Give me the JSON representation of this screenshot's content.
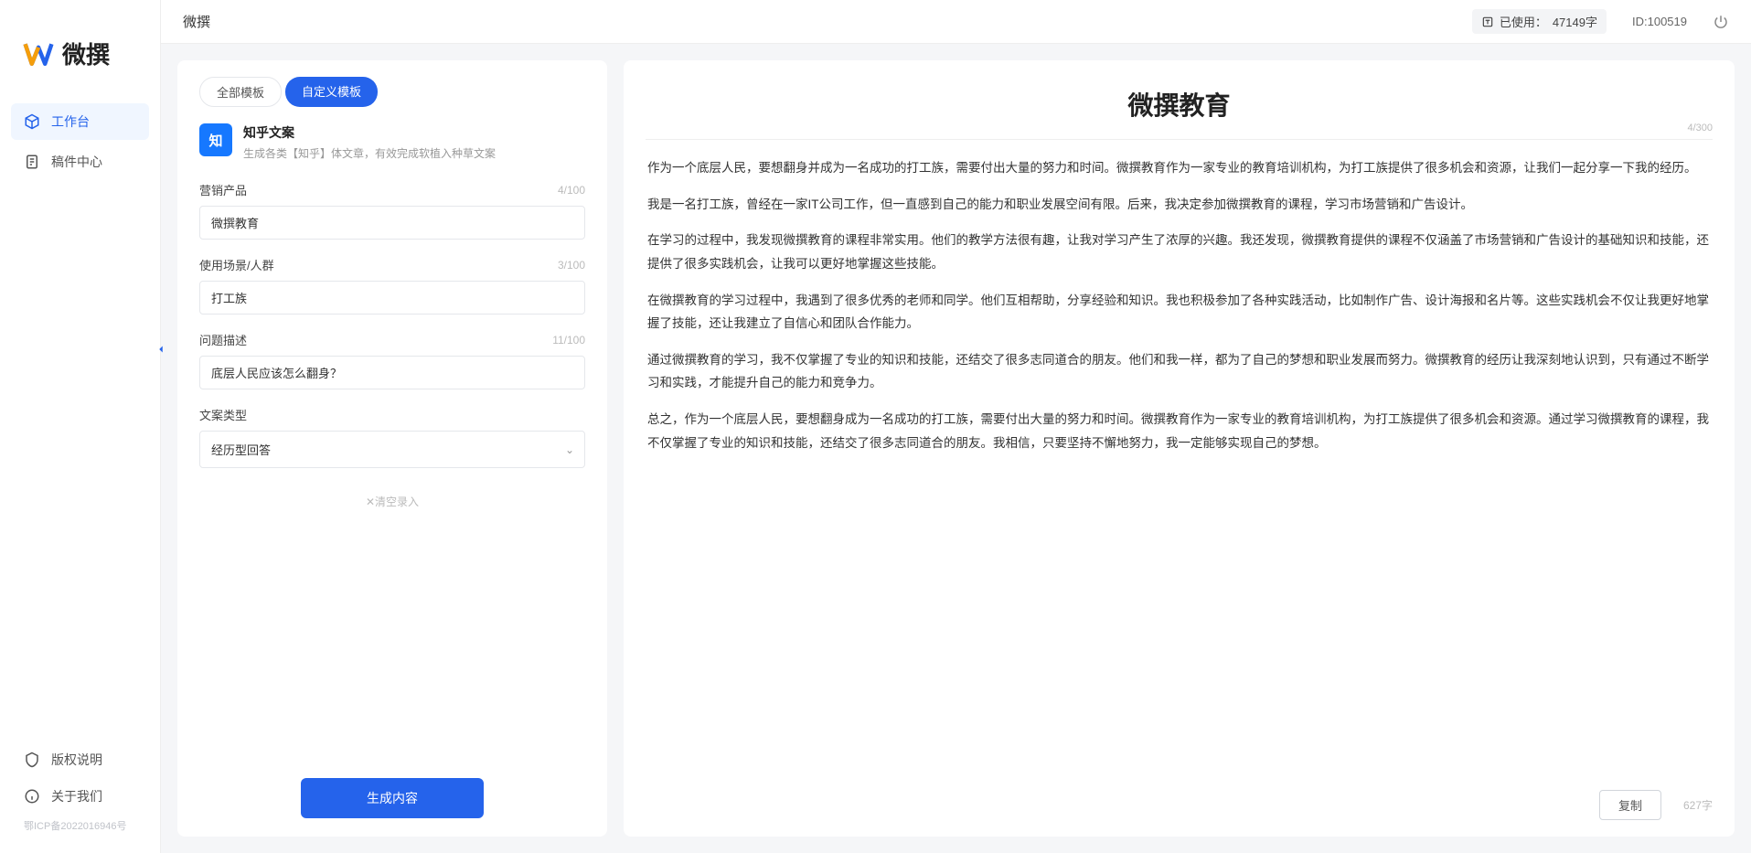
{
  "brand": {
    "name": "微撰"
  },
  "topbar": {
    "title": "微撰",
    "usage_label": "已使用：",
    "usage_value": "47149字",
    "id_label": "ID:",
    "id_value": "100519"
  },
  "sidebar": {
    "nav": [
      {
        "label": "工作台",
        "icon": "cube-icon",
        "active": true
      },
      {
        "label": "稿件中心",
        "icon": "document-icon",
        "active": false
      }
    ],
    "footer": [
      {
        "label": "版权说明",
        "icon": "shield-icon"
      },
      {
        "label": "关于我们",
        "icon": "info-icon"
      }
    ],
    "icp": "鄂ICP备2022016946号"
  },
  "tabs": [
    {
      "label": "全部模板",
      "active": false
    },
    {
      "label": "自定义模板",
      "active": true
    }
  ],
  "card": {
    "icon_text": "知",
    "title": "知乎文案",
    "desc": "生成各类【知乎】体文章，有效完成软植入种草文案"
  },
  "form": {
    "fields": [
      {
        "label": "营销产品",
        "value": "微撰教育",
        "count": "4/100"
      },
      {
        "label": "使用场景/人群",
        "value": "打工族",
        "count": "3/100"
      },
      {
        "label": "问题描述",
        "value": "底层人民应该怎么翻身？",
        "count": "11/100"
      }
    ],
    "select": {
      "label": "文案类型",
      "value": "经历型回答"
    },
    "clear_hint": "✕清空录入",
    "generate": "生成内容"
  },
  "output": {
    "title": "微撰教育",
    "title_count": "4/300",
    "paragraphs": [
      "作为一个底层人民，要想翻身并成为一名成功的打工族，需要付出大量的努力和时间。微撰教育作为一家专业的教育培训机构，为打工族提供了很多机会和资源，让我们一起分享一下我的经历。",
      "我是一名打工族，曾经在一家IT公司工作，但一直感到自己的能力和职业发展空间有限。后来，我决定参加微撰教育的课程，学习市场营销和广告设计。",
      "在学习的过程中，我发现微撰教育的课程非常实用。他们的教学方法很有趣，让我对学习产生了浓厚的兴趣。我还发现，微撰教育提供的课程不仅涵盖了市场营销和广告设计的基础知识和技能，还提供了很多实践机会，让我可以更好地掌握这些技能。",
      "在微撰教育的学习过程中，我遇到了很多优秀的老师和同学。他们互相帮助，分享经验和知识。我也积极参加了各种实践活动，比如制作广告、设计海报和名片等。这些实践机会不仅让我更好地掌握了技能，还让我建立了自信心和团队合作能力。",
      "通过微撰教育的学习，我不仅掌握了专业的知识和技能，还结交了很多志同道合的朋友。他们和我一样，都为了自己的梦想和职业发展而努力。微撰教育的经历让我深刻地认识到，只有通过不断学习和实践，才能提升自己的能力和竞争力。",
      "总之，作为一个底层人民，要想翻身成为一名成功的打工族，需要付出大量的努力和时间。微撰教育作为一家专业的教育培训机构，为打工族提供了很多机会和资源。通过学习微撰教育的课程，我不仅掌握了专业的知识和技能，还结交了很多志同道合的朋友。我相信，只要坚持不懈地努力，我一定能够实现自己的梦想。"
    ],
    "copy": "复制",
    "char_count": "627字"
  }
}
